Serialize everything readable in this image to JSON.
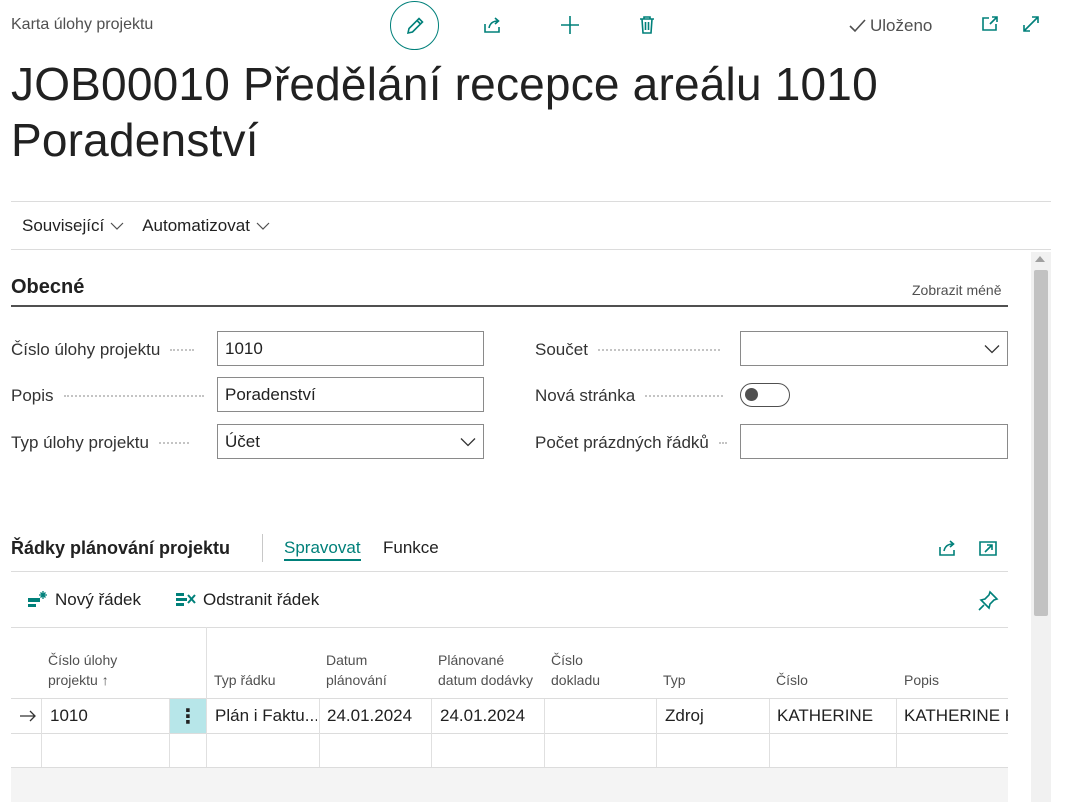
{
  "header": {
    "breadcrumb": "Karta úlohy projektu",
    "saved_label": "Uloženo",
    "title_line1": "JOB00010 Předělání recepce areálu 1010",
    "title_line2": "Poradenství"
  },
  "actions": {
    "related": "Související",
    "automate": "Automatizovat"
  },
  "general": {
    "title": "Obecné",
    "show_less": "Zobrazit méně",
    "fields": {
      "task_no_label": "Číslo úlohy projektu",
      "task_no_value": "1010",
      "description_label": "Popis",
      "description_value": "Poradenství",
      "task_type_label": "Typ úlohy projektu",
      "task_type_value": "Účet",
      "totaling_label": "Součet",
      "totaling_value": "",
      "new_page_label": "Nová stránka",
      "new_page_value": false,
      "blank_lines_label": "Počet prázdných řádků",
      "blank_lines_value": ""
    }
  },
  "lines": {
    "title": "Řádky plánování projektu",
    "tabs": [
      "Spravovat",
      "Funkce"
    ],
    "new_line": "Nový řádek",
    "delete_line": "Odstranit řádek",
    "columns": {
      "task_no": "Číslo úlohy projektu",
      "line_type": "Typ řádku",
      "planning_date": "Datum plánování",
      "planned_delivery": "Plánované datum dodávky",
      "doc_no": "Číslo dokladu",
      "type": "Typ",
      "no": "Číslo",
      "description": "Popis"
    },
    "rows": [
      {
        "task_no": "1010",
        "line_type": "Plán i Faktu...",
        "planning_date": "24.01.2024",
        "planned_delivery": "24.01.2024",
        "doc_no": "",
        "type": "Zdroj",
        "no": "KATHERINE",
        "description": "KATHERINE H"
      }
    ]
  },
  "colors": {
    "accent": "#00807a",
    "selected_cell": "#b7e6e9"
  }
}
